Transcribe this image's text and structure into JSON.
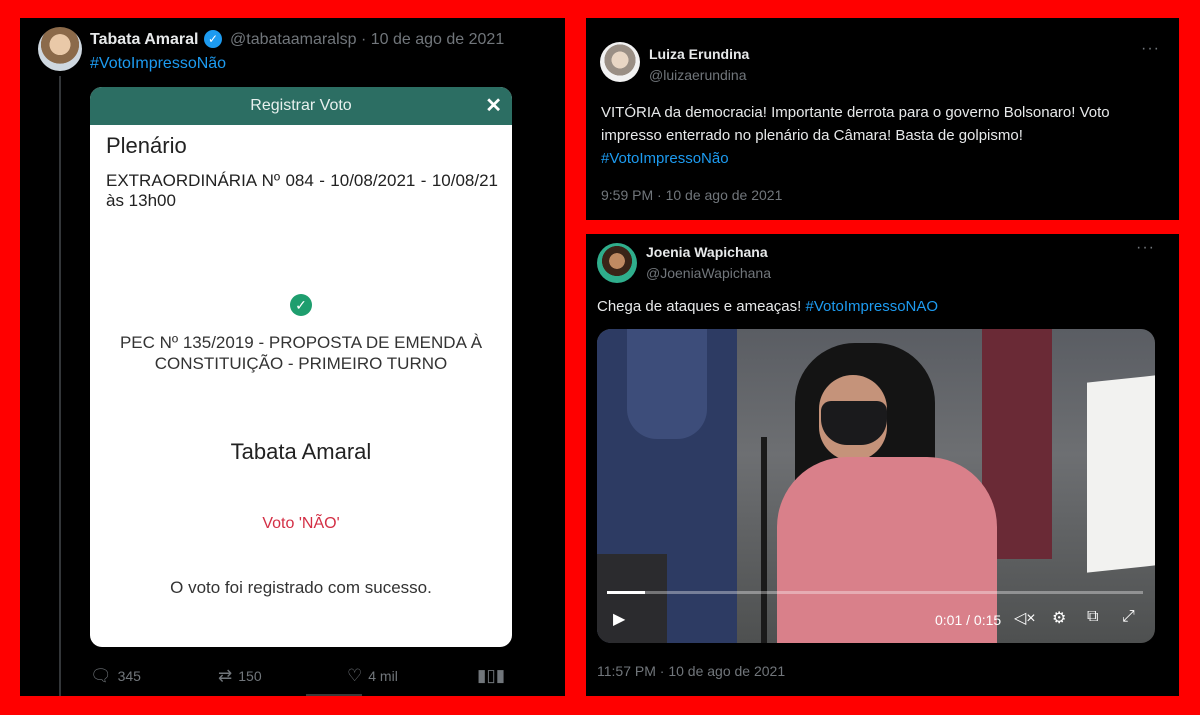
{
  "tweet1": {
    "author": "Tabata Amaral",
    "handle": "@tabataamaralsp",
    "date": "10 de ago de 2021",
    "handle_date": "@tabataamaralsp · 10 de ago de 2021",
    "hashtag": "#VotoImpressoNão",
    "card": {
      "header": "Registrar Voto",
      "close_icon": "✕",
      "title": "Plenário",
      "session": "EXTRAORDINÁRIA Nº 084 - 10/08/2021 - 10/08/21 às 13h00",
      "pec": "PEC Nº 135/2019 - PROPOSTA DE EMENDA À CONSTITUIÇÃO - PRIMEIRO TURNO",
      "person": "Tabata Amaral",
      "vote": "Voto 'NÃO'",
      "confirmation": "O voto foi registrado com sucesso."
    },
    "actions": {
      "replies": "345",
      "retweets": "150",
      "likes": "4 mil"
    }
  },
  "tweet2": {
    "author": "Luiza Erundina",
    "handle": "@luizaerundina",
    "text": "VITÓRIA da democracia! Importante derrota para o governo Bolsonaro! Voto impresso enterrado no plenário da Câmara! Basta de golpismo!",
    "hashtag": "#VotoImpressoNão",
    "time": "9:59 PM · 10 de ago de 2021"
  },
  "tweet3": {
    "author": "Joenia Wapichana",
    "handle": "@JoeniaWapichana",
    "text": "Chega de ataques e ameaças!",
    "hashtag": "#VotoImpressoNAO",
    "video": {
      "time": "0:01 / 0:15",
      "progress": 0.07
    },
    "time": "11:57 PM · 10 de ago de 2021"
  },
  "icons": {
    "more": "···",
    "play": "▶",
    "mute": "🔇︎",
    "settings": "⚙",
    "popout": "⧉",
    "fullscreen": "⤢"
  },
  "colors": {
    "border": "#ff0000",
    "link": "#1d9bf0",
    "card_header": "#2c6e63",
    "vote_red": "#d32f45"
  }
}
